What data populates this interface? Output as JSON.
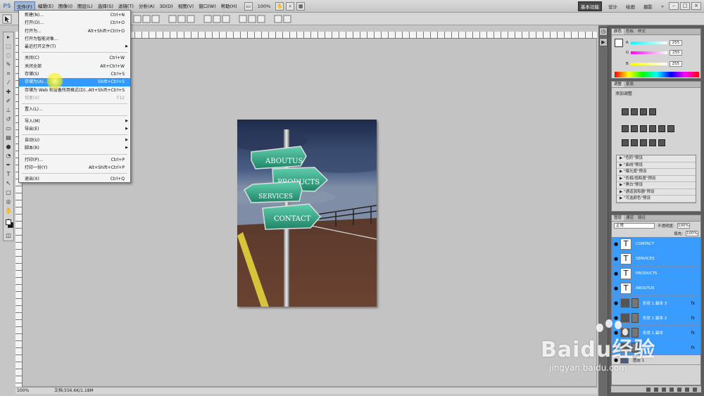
{
  "menubar": {
    "app_logo": "PS",
    "items": [
      "文件(F)",
      "编辑(E)",
      "图像(I)",
      "图层(L)",
      "选择(S)",
      "滤镜(T)",
      "分析(A)",
      "3D(D)",
      "视图(V)",
      "窗口(W)",
      "帮助(H)"
    ],
    "zoom": "100%",
    "workspaces": [
      "基本功能",
      "设计",
      "绘画",
      "摄影"
    ],
    "workspace_more": "»",
    "window_controls": [
      "–",
      "□",
      "×"
    ]
  },
  "file_menu": {
    "items": [
      {
        "label": "新建(N)...",
        "shortcut": "Ctrl+N"
      },
      {
        "label": "打开(O)...",
        "shortcut": "Ctrl+O"
      },
      {
        "label": "打开为...",
        "shortcut": "Alt+Shift+Ctrl+O"
      },
      {
        "label": "打开为智能对象...",
        "shortcut": ""
      },
      {
        "label": "最近打开文件(T)",
        "shortcut": "",
        "submenu": true
      },
      {
        "sep": true
      },
      {
        "label": "关闭(C)",
        "shortcut": "Ctrl+W"
      },
      {
        "label": "关闭全部",
        "shortcut": "Alt+Ctrl+W"
      },
      {
        "label": "存储(S)",
        "shortcut": "Ctrl+S"
      },
      {
        "label": "存储为(A)...",
        "shortcut": "Shift+Ctrl+S",
        "highlight": true
      },
      {
        "label": "存储为 Web 和设备所用格式(D)...",
        "shortcut": "Alt+Shift+Ctrl+S"
      },
      {
        "label": "恢复(V)",
        "shortcut": "F12",
        "disabled": true
      },
      {
        "sep": true
      },
      {
        "label": "置入(L)...",
        "shortcut": ""
      },
      {
        "sep": true
      },
      {
        "label": "导入(M)",
        "shortcut": "",
        "submenu": true
      },
      {
        "label": "导出(E)",
        "shortcut": "",
        "submenu": true
      },
      {
        "sep": true
      },
      {
        "label": "自动(U)",
        "shortcut": "",
        "submenu": true
      },
      {
        "label": "脚本(R)",
        "shortcut": "",
        "submenu": true
      },
      {
        "sep": true
      },
      {
        "label": "打印(P)...",
        "shortcut": "Ctrl+P"
      },
      {
        "label": "打印一份(Y)",
        "shortcut": "Alt+Shift+Ctrl+P"
      },
      {
        "sep": true
      },
      {
        "label": "退出(X)",
        "shortcut": "Ctrl+Q"
      }
    ]
  },
  "canvas": {
    "signs": [
      "ABOUTUS",
      "PRODUCTS",
      "SERVICES",
      "CONTACT"
    ]
  },
  "status": {
    "zoom": "100%",
    "doc_info": "文档:556.6K/1.18M"
  },
  "color_panel": {
    "tabs": [
      "颜色",
      "色板",
      "样式"
    ],
    "channels": [
      {
        "label": "R",
        "value": "255"
      },
      {
        "label": "G",
        "value": "255"
      },
      {
        "label": "B",
        "value": "255"
      }
    ]
  },
  "adjust_panel": {
    "tabs": [
      "调整",
      "蒙版"
    ],
    "title": "添加调整",
    "presets": [
      "\"色阶\"预设",
      "\"曲线\"预设",
      "\"曝光度\"预设",
      "\"色相/饱和度\"预设",
      "\"黑白\"预设",
      "\"通道混和器\"预设",
      "\"可选颜色\"预设"
    ]
  },
  "layers_panel": {
    "tabs": [
      "图层",
      "通道",
      "路径"
    ],
    "blend_mode": "正常",
    "opacity_label": "不透明度:",
    "opacity": "100%",
    "fill_label": "填充:",
    "fill": "100%",
    "text_layers": [
      "CONTACT",
      "SERVICES",
      "PRODUCTS",
      "ABOUTUS"
    ],
    "shape_layers": [
      "形状 1 副本 3",
      "形状 1 副本 2",
      "形状 1 副本",
      "形状 1"
    ],
    "background_layer": "图层 1",
    "fx": "fx"
  },
  "watermark": {
    "brand": "Baidu经验",
    "url": "jingyan.baidu.com"
  }
}
